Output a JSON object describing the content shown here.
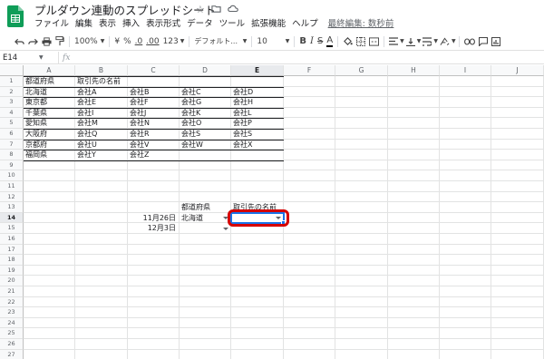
{
  "doc": {
    "title": "プルダウン連動のスプレッドシート",
    "star_icon": "star-icon",
    "folder_icon": "folder-icon",
    "cloud_icon": "cloud-icon"
  },
  "menu": [
    "ファイル",
    "編集",
    "表示",
    "挿入",
    "表示形式",
    "データ",
    "ツール",
    "拡張機能",
    "ヘルプ"
  ],
  "last_edit": "最終編集: 数秒前",
  "toolbar": {
    "zoom": "100%",
    "currency": "¥",
    "percent": "%",
    "dec_decrease": ".0",
    "dec_increase": ".00",
    "number_format": "123",
    "font": "デフォルト...",
    "font_size": "10",
    "bold": "B",
    "italic": "I",
    "strike": "S",
    "text_color": "A"
  },
  "name_box": "E14",
  "fx": "fx",
  "columns": [
    "A",
    "B",
    "C",
    "D",
    "E",
    "F",
    "G",
    "H",
    "I",
    "J"
  ],
  "selected_column": "E",
  "selected_row": 14,
  "rows": [
    "1",
    "2",
    "3",
    "4",
    "5",
    "6",
    "7",
    "8",
    "9",
    "10",
    "11",
    "12",
    "13",
    "14",
    "15",
    "16",
    "17",
    "18",
    "19",
    "20",
    "21",
    "22",
    "23",
    "24",
    "25",
    "26",
    "27"
  ],
  "table": {
    "headers": [
      "都道府県",
      "取引先の名前"
    ],
    "rows": [
      [
        "北海道",
        "会社A",
        "会社B",
        "会社C",
        "会社D"
      ],
      [
        "東京都",
        "会社E",
        "会社F",
        "会社G",
        "会社H"
      ],
      [
        "千葉県",
        "会社I",
        "会社J",
        "会社K",
        "会社L"
      ],
      [
        "愛知県",
        "会社M",
        "会社N",
        "会社O",
        "会社P"
      ],
      [
        "大阪府",
        "会社Q",
        "会社R",
        "会社S",
        "会社S"
      ],
      [
        "京都府",
        "会社U",
        "会社V",
        "会社W",
        "会社X"
      ],
      [
        "福岡県",
        "会社Y",
        "会社Z",
        "",
        ""
      ]
    ]
  },
  "form": {
    "header_d13": "都道府県",
    "header_e13": "取引先の名前",
    "c14": "11月26日",
    "d14": "北海道",
    "c15": "12月3日",
    "d15": ""
  },
  "colors": {
    "selection": "#1a73e8",
    "highlight": "#d50000",
    "sheets_green": "#0f9d58"
  }
}
